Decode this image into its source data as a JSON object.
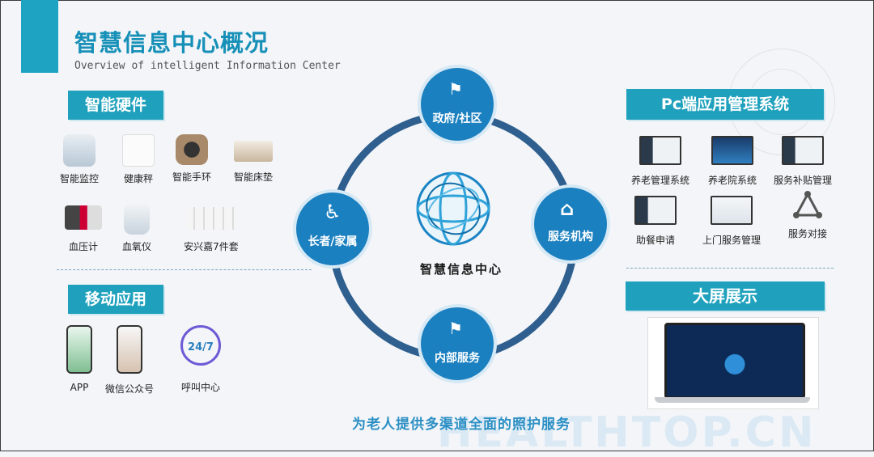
{
  "header": {
    "title": "智慧信息中心概况",
    "subtitle": "Overview of intelligent Information Center"
  },
  "hardware": {
    "tag": "智能硬件",
    "items": [
      "智能监控",
      "健康秤",
      "智能手环",
      "智能床垫",
      "血压计",
      "血氧仪",
      "安兴嘉7件套"
    ]
  },
  "mobile": {
    "tag": "移动应用",
    "items": [
      "APP",
      "微信公众号",
      "呼叫中心"
    ],
    "call_badge": "24/7"
  },
  "pc": {
    "tag": "Pc端应用管理系统",
    "items": [
      "养老管理系统",
      "养老院系统",
      "服务补贴管理",
      "助餐申请",
      "上门服务管理",
      "服务对接"
    ]
  },
  "screen": {
    "tag": "大屏展示"
  },
  "diagram": {
    "center": "智慧信息中心",
    "nodes": {
      "top": "政府/社区",
      "right": "服务机构",
      "bottom": "内部服务",
      "left": "长者/家属"
    }
  },
  "slogan": "为老人提供多渠道全面的照护服务",
  "watermark": "HEALTHTOP.CN",
  "colors": {
    "accent": "#1fa1bd",
    "node": "#1b80c0",
    "ring": "#2f5f8f",
    "title": "#1790b8"
  }
}
